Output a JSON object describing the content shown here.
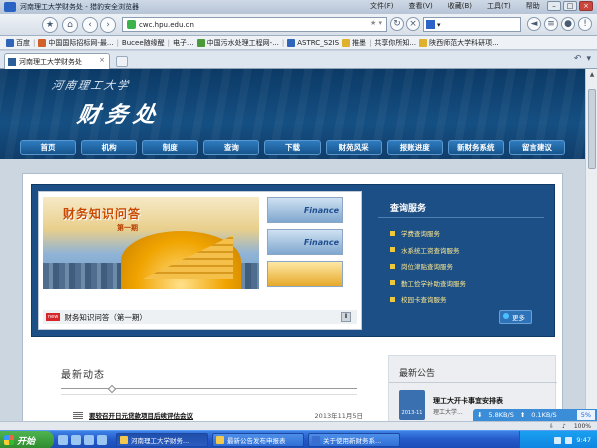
{
  "browser": {
    "window_title": "河南理工大学财务处 - 猎豹安全浏览器",
    "menus": [
      "文件(F)",
      "查看(V)",
      "收藏(B)",
      "工具(T)",
      "帮助"
    ],
    "address": "cwc.hpu.edu.cn",
    "bookmarks": [
      "百度",
      "中国国际招标网-最...",
      "Bucee随缘醒",
      "电子...",
      "中国污水处理工程网-...",
      "ASTRC_S2IS",
      "推墨",
      "共享你所知...",
      "陕西师范大学科研项..."
    ],
    "tab_title": "河南理工大学财务处"
  },
  "site": {
    "school_name": "河南理工大学",
    "dept_name": "财务处",
    "nav": [
      "首页",
      "机构",
      "制度",
      "查询",
      "下载",
      "财苑风采",
      "报账进度",
      "新财务系统",
      "留言建议"
    ],
    "slide": {
      "headline": "财务知识问答",
      "issue": "第一期",
      "caption": "财务知识问答（第一期）",
      "new_tag": "new",
      "thumb_label": "Finance",
      "pause": "Ⅱ"
    },
    "query": {
      "title": "查询服务",
      "items": [
        "学费查询服务",
        "水系统工资查询服务",
        "岗位津贴查询服务",
        "勤工俭学补助查询服务",
        "校园卡查询服务"
      ],
      "more": "更多"
    },
    "news": {
      "title": "最新动态",
      "item_title": "要较召开日元贷款项目后续评估会议",
      "item_date": "2013年11月5日"
    },
    "announce": {
      "title": "最新公告",
      "cal_label": "2013-11",
      "item_title": "理工大开卡事宜安排表",
      "item_sub": "理工大学..."
    }
  },
  "status": {
    "down_speed": "5.8KB/S",
    "up_speed": "0.1KB/S",
    "percent": "5%",
    "zoom": "100%"
  },
  "taskbar": {
    "start": "开始",
    "tasks": [
      "河南理工大学财务...",
      "最新公告发布申报表",
      "关于使用新财务系..."
    ],
    "time": "9:47"
  }
}
